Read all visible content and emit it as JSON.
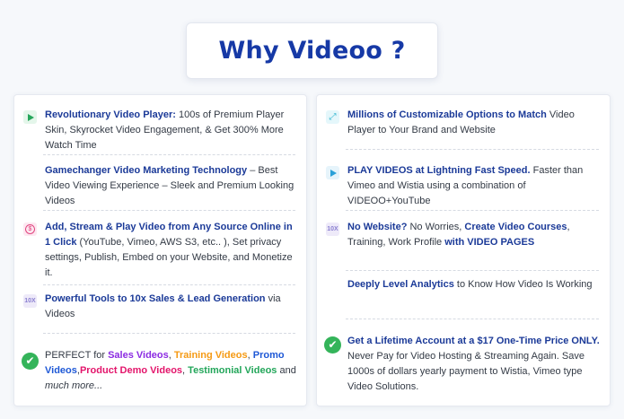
{
  "title": "Why Videoo ?",
  "left": [
    {
      "icon": "play-icon",
      "parts": [
        {
          "t": "Revolutionary Video Player:",
          "c": "b"
        },
        {
          "t": " 100s of Premium Player Skin, Skyrocket Video Engagement, & Get 300% More Watch Time",
          "c": ""
        }
      ]
    },
    {
      "icon": "",
      "parts": [
        {
          "t": "Gamechanger Video Marketing Technology",
          "c": "b"
        },
        {
          "t": " – Best Video Viewing Experience – Sleek and Premium Looking Videos",
          "c": ""
        }
      ]
    },
    {
      "icon": "dollar-icon",
      "parts": [
        {
          "t": "Add, Stream & Play Video from Any Source Online in 1 Click",
          "c": "b"
        },
        {
          "t": " (YouTube, Vimeo, AWS S3, etc.. ), Set privacy settings, Publish, Embed on your Website, and Monetize it.",
          "c": ""
        }
      ]
    },
    {
      "icon": "10x-icon",
      "icon_text": "10X",
      "parts": [
        {
          "t": "Powerful Tools to 10x Sales & Lead Generation",
          "c": "b"
        },
        {
          "t": " via Videos",
          "c": ""
        }
      ]
    },
    {
      "icon": "check-icon",
      "parts": [
        {
          "t": "PERFECT for ",
          "c": ""
        },
        {
          "t": "Sales Videos",
          "c": "purple"
        },
        {
          "t": ", ",
          "c": ""
        },
        {
          "t": "Training Videos",
          "c": "orange"
        },
        {
          "t": ", ",
          "c": ""
        },
        {
          "t": "Promo Videos",
          "c": "blue"
        },
        {
          "t": ",",
          "c": ""
        },
        {
          "t": "Product Demo Videos",
          "c": "pink"
        },
        {
          "t": ", ",
          "c": ""
        },
        {
          "t": "Testimonial Videos",
          "c": "green"
        },
        {
          "t": " and ",
          "c": ""
        },
        {
          "t": "much more...",
          "c": "em"
        }
      ]
    }
  ],
  "right": [
    {
      "icon": "expand-icon",
      "parts": [
        {
          "t": "Millions of Customizable Options to Match",
          "c": "b"
        },
        {
          "t": " Video Player to Your Brand and Website",
          "c": ""
        }
      ]
    },
    {
      "icon": "play-icon",
      "parts": [
        {
          "t": "PLAY VIDEOS at Lightning Fast Speed.",
          "c": "b"
        },
        {
          "t": " Faster than Vimeo and Wistia using a combination of VIDEOO+YouTube",
          "c": ""
        }
      ]
    },
    {
      "icon": "10x-icon",
      "icon_text": "10X",
      "parts": [
        {
          "t": "No Website?",
          "c": "b"
        },
        {
          "t": " No Worries, ",
          "c": ""
        },
        {
          "t": "Create Video Courses",
          "c": "b"
        },
        {
          "t": ", Training, Work Profile ",
          "c": ""
        },
        {
          "t": "with VIDEO PAGES",
          "c": "b"
        }
      ]
    },
    {
      "icon": "",
      "parts": [
        {
          "t": "Deeply Level Analytics",
          "c": "b"
        },
        {
          "t": " to Know How Video Is Working",
          "c": ""
        }
      ]
    },
    {
      "icon": "check-icon",
      "parts": [
        {
          "t": "Get a Lifetime Account at a $17 One-Time Price ONLY.",
          "c": "b"
        },
        {
          "t": " Never Pay for Video Hosting & Streaming Again. Save 1000s of dollars yearly payment to Wistia, Vimeo type Video Solutions.",
          "c": ""
        }
      ]
    }
  ]
}
